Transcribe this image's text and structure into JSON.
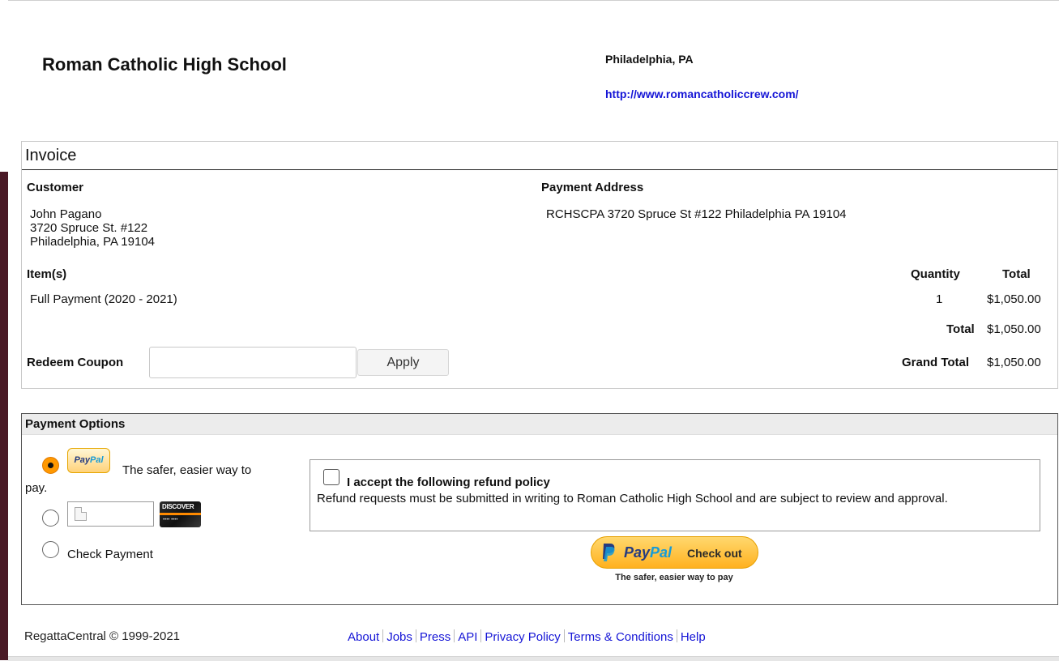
{
  "header": {
    "school_name": "Roman Catholic High School",
    "location": "Philadelphia, PA",
    "website": "http://www.romancatholiccrew.com/"
  },
  "invoice": {
    "title": "Invoice",
    "customer_label": "Customer",
    "customer_lines": [
      "John Pagano",
      "3720 Spruce St. #122",
      "Philadelphia, PA 19104"
    ],
    "payment_address_label": "Payment Address",
    "payment_address": "RCHSCPA 3720 Spruce St #122 Philadelphia PA 19104",
    "items_label": "Item(s)",
    "quantity_label": "Quantity",
    "total_label": "Total",
    "items": [
      {
        "name": "Full Payment (2020 - 2021)",
        "quantity": "1",
        "total": "$1,050.00"
      }
    ],
    "subtotal_label": "Total",
    "subtotal": "$1,050.00",
    "coupon_label": "Redeem Coupon",
    "coupon_value": "",
    "apply_label": "Apply",
    "grand_total_label": "Grand Total",
    "grand_total": "$1,050.00"
  },
  "payment": {
    "header": "Payment Options",
    "paypal_logo_text": [
      "Pay",
      "Pal"
    ],
    "paypal_tagline_a": "The safer, easier way to",
    "paypal_tagline_b": "pay.",
    "card_logo_text": "DISCOVER",
    "check_label": "Check Payment",
    "selected_option": "paypal",
    "refund_checkbox_checked": false,
    "refund_title": "I accept the following refund policy",
    "refund_text": "Refund requests must be submitted in writing to Roman Catholic High School and are subject to review and approval.",
    "checkout_button": {
      "word_a": "Pay",
      "word_b": "Pal",
      "action": "Check out"
    },
    "checkout_tagline": "The safer, easier way to pay"
  },
  "footer": {
    "copyright": "RegattaCentral © 1999-2021",
    "links": [
      "About",
      "Jobs",
      "Press",
      "API",
      "Privacy Policy",
      "Terms & Conditions",
      "Help"
    ]
  },
  "colors": {
    "link": "#1515d6",
    "paypal_orange": "#ffb11f",
    "paypal_dark_blue": "#253b80",
    "paypal_light_blue": "#179bd7",
    "left_bar": "#4a1a26"
  }
}
